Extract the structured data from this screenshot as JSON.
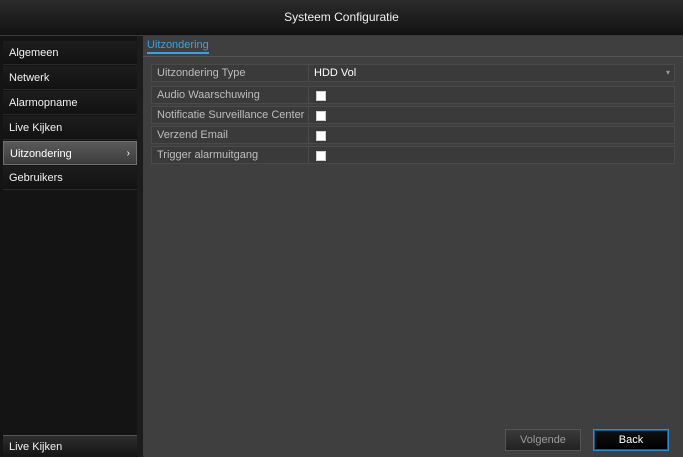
{
  "window": {
    "title": "Systeem Configuratie"
  },
  "sidebar": {
    "items": [
      {
        "label": "Algemeen"
      },
      {
        "label": "Netwerk"
      },
      {
        "label": "Alarmopname"
      },
      {
        "label": "Live Kijken"
      },
      {
        "label": "Uitzondering",
        "active": true
      },
      {
        "label": "Gebruikers"
      }
    ],
    "bottom_label": "Live Kijken",
    "chevron": "›"
  },
  "main": {
    "tab_label": "Uitzondering",
    "rows": [
      {
        "label": "Uitzondering Type",
        "value": "HDD Vol"
      },
      {
        "label": "Audio Waarschuwing",
        "checked": true
      },
      {
        "label": "Notificatie Surveillance Center",
        "checked": true
      },
      {
        "label": "Verzend Email",
        "checked": true
      },
      {
        "label": "Trigger alarmuitgang",
        "checked": true
      }
    ],
    "dropdown_icon": "▾"
  },
  "buttons": {
    "next_label": "Volgende",
    "back_label": "Back"
  },
  "colors": {
    "accent": "#3aa0e6",
    "panel": "#3f3f3f",
    "sidebar": "#141414"
  }
}
